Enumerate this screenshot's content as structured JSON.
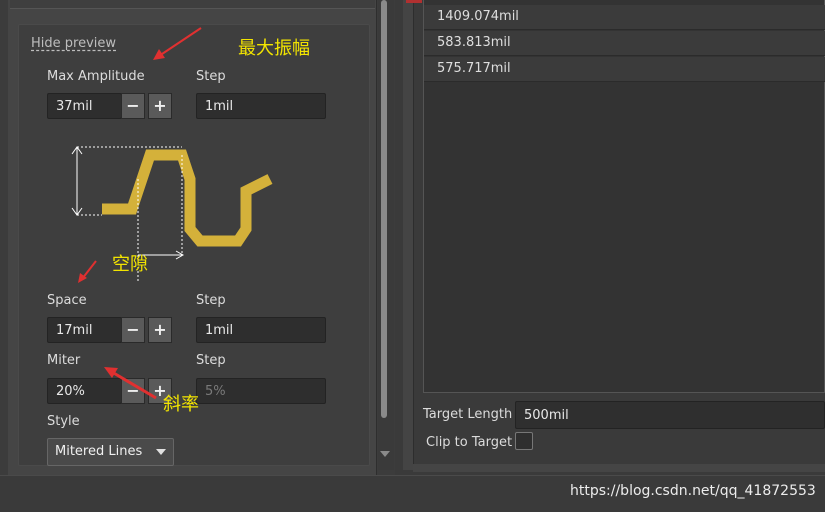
{
  "preview": {
    "hide_label": "Hide preview",
    "max_amplitude": {
      "label": "Max Amplitude",
      "value": "37mil",
      "step_label": "Step",
      "step_value": "1mil"
    },
    "space": {
      "label": "Space",
      "value": "17mil",
      "step_label": "Step",
      "step_value": "1mil"
    },
    "miter": {
      "label": "Miter",
      "value": "20%",
      "step_label": "Step",
      "step_value": "5%"
    },
    "style": {
      "label": "Style",
      "value": "Mitered Lines"
    },
    "minus": "−",
    "plus": "+"
  },
  "annotations": {
    "amplitude": "最大振幅",
    "gap": "空隙",
    "slope": "斜率"
  },
  "lengths": [
    "1409.074mil",
    "583.813mil",
    "575.717mil"
  ],
  "target": {
    "label": "Target Length",
    "value": "500mil",
    "clip_label": "Clip to Target"
  },
  "watermark": "https://blog.csdn.net/qq_41872553",
  "colors": {
    "trace": "#d4b13a",
    "annotation": "#f2e400",
    "arrow": "#e03030"
  }
}
